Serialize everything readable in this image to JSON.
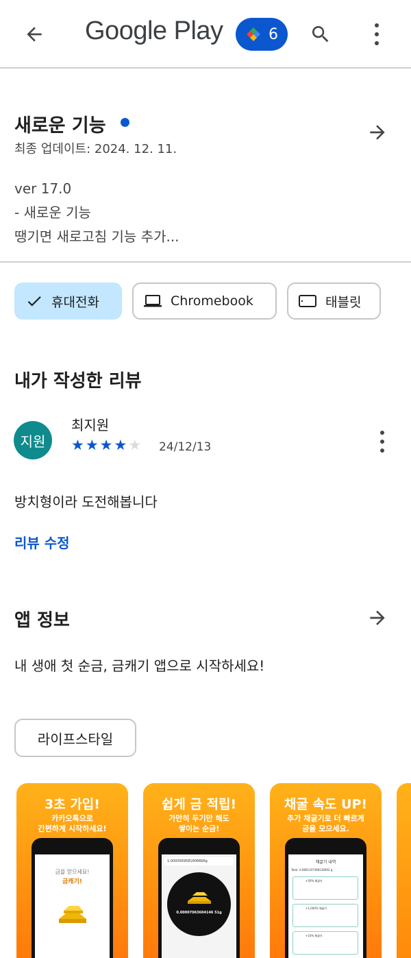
{
  "header": {
    "title": "Google Play",
    "badge_count": "6"
  },
  "whats_new": {
    "title": "새로운 기능",
    "last_updated": "최종 업데이트: 2024. 12. 11.",
    "notes": [
      "ver 17.0",
      "- 새로운 기능",
      "땡기면 새로고침 기능 추가..."
    ]
  },
  "device_chips": [
    {
      "label": "휴대전화",
      "icon": "check-icon",
      "selected": true
    },
    {
      "label": "Chromebook",
      "icon": "laptop-icon",
      "selected": false
    },
    {
      "label": "태블릿",
      "icon": "tablet-icon",
      "selected": false
    }
  ],
  "my_review": {
    "heading": "내가 작성한 리뷰",
    "avatar_text": "지원",
    "author": "최지원",
    "rating": 4,
    "max_rating": 5,
    "date": "24/12/13",
    "text": "방치형이라 도전해봅니다",
    "edit_label": "리뷰 수정"
  },
  "app_info": {
    "heading": "앱 정보",
    "description": "내 생애 첫 순금, 금캐기 앱으로 시작하세요!",
    "category": "라이프스타일"
  },
  "screenshots": [
    {
      "title": "3초 가입!",
      "subtitle": [
        "카카오톡으로",
        "간편하게 시작하세요!"
      ],
      "screen_lines": [
        "금을 얻으세요!",
        "금캐기!"
      ]
    },
    {
      "title": "쉽게 금 적립!",
      "subtitle": [
        "가만히 두기만 해도",
        "쌓이는 순금!"
      ],
      "screen_lines": [
        "1.0000569581606666g",
        "0.00007063604146 51g"
      ]
    },
    {
      "title": "채굴 속도 UP!",
      "subtitle": [
        "추가 채굴기로 더 빠르게",
        "금을 모으세요."
      ],
      "screen_lines": [
        "채굴기 내역",
        "Total: 0.0801207498136092 g",
        "+50% 채굴기",
        "+1,000% 채굴기",
        "+10% 채굴기"
      ]
    }
  ],
  "colors": {
    "accent": "#0b57d0",
    "chip_selected": "#c2e7ff",
    "avatar": "#0f8b8d",
    "screenshot_orange": "#ff9410"
  }
}
